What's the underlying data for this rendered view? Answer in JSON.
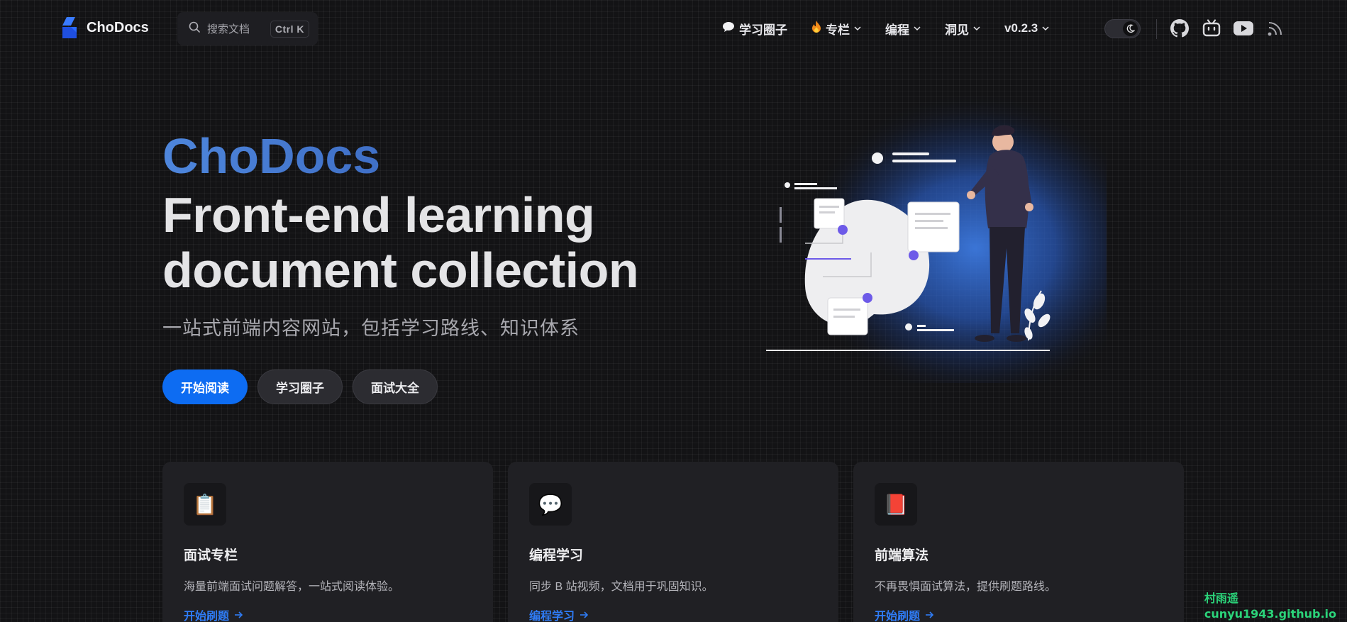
{
  "nav": {
    "brand": "ChoDocs",
    "search_placeholder": "搜索文档",
    "search_shortcut": "Ctrl K",
    "items": [
      {
        "label": "学习圈子",
        "icon": "speech-bubble-icon",
        "has_dropdown": false
      },
      {
        "label": "专栏",
        "icon": "fire-icon",
        "has_dropdown": true
      },
      {
        "label": "编程",
        "has_dropdown": true
      },
      {
        "label": "洞见",
        "has_dropdown": true
      },
      {
        "label": "v0.2.3",
        "has_dropdown": true
      }
    ],
    "social": [
      "github-icon",
      "bilibili-icon",
      "youtube-icon",
      "rss-icon"
    ]
  },
  "hero": {
    "name": "ChoDocs",
    "text": "Front-end learning document collection",
    "tagline": "一站式前端内容网站，包括学习路线、知识体系",
    "actions": [
      {
        "label": "开始阅读",
        "theme": "brand"
      },
      {
        "label": "学习圈子",
        "theme": "alt"
      },
      {
        "label": "面试大全",
        "theme": "alt"
      }
    ]
  },
  "features": [
    {
      "icon": "📋",
      "icon_name": "clipboard-icon",
      "title": "面试专栏",
      "details": "海量前端面试问题解答，一站式阅读体验。",
      "link": "开始刷题"
    },
    {
      "icon": "💬",
      "icon_name": "speech-balloon-icon",
      "title": "编程学习",
      "details": "同步 B 站视频，文档用于巩固知识。",
      "link": "编程学习"
    },
    {
      "icon": "📕",
      "icon_name": "book-icon",
      "title": "前端算法",
      "details": "不再畏惧面试算法，提供刷题路线。",
      "link": "开始刷题"
    }
  ],
  "watermark": {
    "line1": "村雨遥",
    "line2": "cunyu1943.github.io"
  },
  "colors": {
    "brand": "#0d6cf2",
    "hero_name": "#4a7fd6",
    "background": "#131315",
    "card": "#202024",
    "link": "#2f7cf6"
  }
}
